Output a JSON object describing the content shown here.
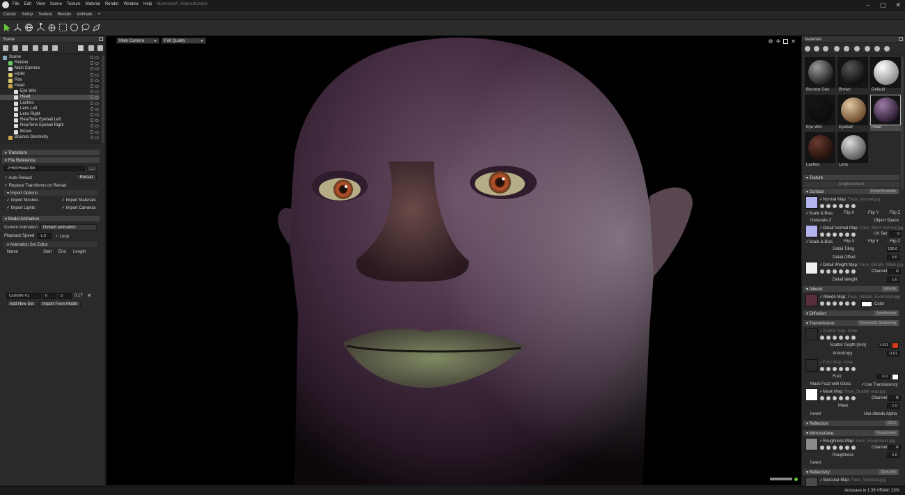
{
  "titlebar": {
    "menus": [
      "File",
      "Edit",
      "View",
      "Scene",
      "Texture",
      "Material",
      "Render",
      "Window",
      "Help"
    ],
    "file_name": "Marmoset4_Scene.tbscene"
  },
  "tabs": [
    "Classic",
    "Setup",
    "Texture",
    "Render",
    "Animate",
    "+"
  ],
  "scene": {
    "header": "Scene",
    "tree": [
      {
        "label": "Scene",
        "indent": 0,
        "icon": "scene-icon",
        "color": "#8ab"
      },
      {
        "label": "Render",
        "indent": 1,
        "icon": "render-icon",
        "color": "#6c6"
      },
      {
        "label": "Main Camera",
        "indent": 1,
        "icon": "camera-icon",
        "color": "#ccc"
      },
      {
        "label": "HDRI",
        "indent": 1,
        "icon": "sky-icon",
        "color": "#dc6"
      },
      {
        "label": "Rim",
        "indent": 1,
        "icon": "light-icon",
        "color": "#dc6"
      },
      {
        "label": "Head",
        "indent": 1,
        "icon": "folder-icon",
        "color": "#c9a24a"
      },
      {
        "label": "Eye Wet",
        "indent": 2,
        "icon": "mesh-icon",
        "color": "#ddd"
      },
      {
        "label": "Head",
        "indent": 2,
        "icon": "mesh-icon",
        "color": "#ddd",
        "selected": true
      },
      {
        "label": "Lashes",
        "indent": 2,
        "icon": "mesh-icon",
        "color": "#ddd"
      },
      {
        "label": "Lens Left",
        "indent": 2,
        "icon": "mesh-icon",
        "color": "#ddd"
      },
      {
        "label": "Lens Right",
        "indent": 2,
        "icon": "mesh-icon",
        "color": "#ddd"
      },
      {
        "label": "RealTime Eyeball Left",
        "indent": 2,
        "icon": "mesh-icon",
        "color": "#ddd"
      },
      {
        "label": "RealTime Eyeball Right",
        "indent": 2,
        "icon": "mesh-icon",
        "color": "#ddd"
      },
      {
        "label": "Brows",
        "indent": 2,
        "icon": "mesh-icon",
        "color": "#ddd"
      },
      {
        "label": "Bounce Geometry",
        "indent": 1,
        "icon": "folder-icon",
        "color": "#c9a24a"
      }
    ]
  },
  "props": {
    "transform": "Transform",
    "file_reference": "File Reference",
    "file_path": "./FBX/Head.fbx",
    "browse": "...",
    "auto_reload": "Auto-Reload",
    "reload": "Reload",
    "replace_transforms": "Replace Transforms on Reload",
    "import_options": "Import Options",
    "import_meshes": "Import Meshes",
    "import_materials": "Import Materials",
    "import_lights": "Import Lights",
    "import_cameras": "Import Cameras",
    "model_animation": "Model Animation",
    "current_animation_label": "Current Animation:",
    "current_animation": "Default animation",
    "playback_speed_label": "Playback Speed",
    "playback_speed": "1.0",
    "loop": "Loop",
    "anim_set_editor": "Animation Set Editor",
    "cols": [
      "Name",
      "Start",
      "End",
      "Length"
    ],
    "row": {
      "name": "Custom #1",
      "start": "0",
      "end": "5",
      "length": "0.17"
    },
    "add_new_set": "Add New Set",
    "import_from_model": "Import From Model"
  },
  "viewport": {
    "camera": "Main Camera",
    "quality": "Full Quality"
  },
  "materials": {
    "header": "Materials",
    "thumbs": [
      {
        "label": "Bounce Geo",
        "c1": "#9a9a9a",
        "c2": "#1d1d1d"
      },
      {
        "label": "Brows",
        "c1": "#555",
        "c2": "#0c0c0c"
      },
      {
        "label": "Default",
        "c1": "#ffffff",
        "c2": "#8a8a8a"
      },
      {
        "label": "Eye Wet",
        "c1": "#151515",
        "c2": "#0b0b0b"
      },
      {
        "label": "Eyeball",
        "c1": "#e0c8a0",
        "c2": "#6b4a2a"
      },
      {
        "label": "Head",
        "c1": "#9b7aa6",
        "c2": "#2a1a30",
        "selected": true
      },
      {
        "label": "Lashes",
        "c1": "#6a3a2e",
        "c2": "#1f0f0c"
      },
      {
        "label": "Lens",
        "c1": "#dddddd",
        "c2": "#555"
      }
    ],
    "texture": "Texture",
    "displacement": "Displacement",
    "surface": "Surface",
    "surface_type": "Detail Normals",
    "normal_map": "Normal Map:",
    "normal_file": "Face_Normal.jpg",
    "scale_bias": "Scale & Bias",
    "flip_x": "Flip X",
    "flip_y": "Flip Y",
    "flip_z": "Flip Z",
    "generate_z": "Generate Z",
    "object_space": "Object Space",
    "detail_normal_map": "Detail Normal Map:",
    "detail_normal_file": "Face_Micro Normal.jpg",
    "uv_set": "UV Set",
    "uv_val": "0",
    "detail_tiling": "Detail Tiling",
    "detail_tiling_val": "100.0",
    "detail_offset": "Detail Offset",
    "detail_offset_val": "0.0",
    "detail_weight_map": "Detail Weight Map:",
    "detail_weight_file": "Face_Details_Mask.jpg",
    "channel": "Channel",
    "channel_r": "R",
    "detail_weight": "Detail Weight",
    "detail_weight_val": "1.0",
    "albedo": "Albedo:",
    "albedo_type": "Albedo",
    "albedo_map": "Albedo Map:",
    "albedo_file": "Face_Albedo_Exomorph.jpg",
    "color": "Color",
    "diffusion": "Diffusion:",
    "diffusion_type": "Lambertian",
    "transmission": "Transmission:",
    "transmission_type": "Volumetric Scattering",
    "scatter_map": "Scatter Map:",
    "scatter_none": "none",
    "scatter_depth": "Scatter Depth (mm)",
    "scatter_depth_val": "1.411",
    "scatter_color": "#d43a1a",
    "anisotropy": "Anisotropy",
    "anisotropy_val": "0.01",
    "fuzz_map": "Fuzz Map:",
    "fuzz_none": "none",
    "fuzz": "Fuzz",
    "fuzz_val": "0.0",
    "mask_fuzz": "Mask Fuzz with Gloss",
    "use_translucency": "Use Translucency",
    "mask_map": "Mask Map:",
    "mask_file": "Face_Scatter map.jpg",
    "mask": "Mask",
    "mask_val": "1.0",
    "invert": "Invert",
    "use_albedo_alpha": "Use Albedo Alpha",
    "reflection": "Reflection:",
    "reflection_type": "GGX",
    "microsurface": "Microsurface:",
    "microsurface_type": "Roughness",
    "roughness_map": "Roughness Map:",
    "roughness_file": "Face_Roughness.jpg",
    "roughness": "Roughness",
    "roughness_val": "1.0",
    "reflectivity": "Reflectivity:",
    "reflectivity_type": "Specular",
    "specular_map": "Specular Map:",
    "specular_file": "Face_Specular.jpg"
  },
  "status": {
    "text": "Autosave in 1:39    VRAM: 23%"
  }
}
